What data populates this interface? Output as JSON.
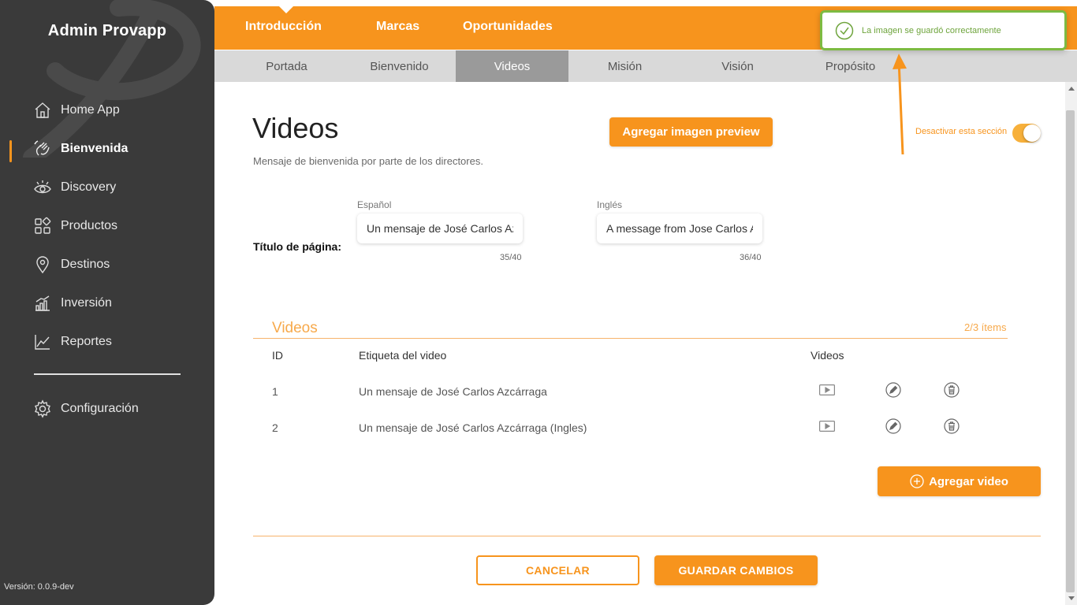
{
  "sidebar": {
    "brand": "Admin Provapp",
    "items": [
      {
        "label": "Home App",
        "icon": "home-icon"
      },
      {
        "label": "Bienvenida",
        "icon": "waving-hand-icon",
        "active": true
      },
      {
        "label": "Discovery",
        "icon": "eye-icon"
      },
      {
        "label": "Productos",
        "icon": "grid-icon"
      },
      {
        "label": "Destinos",
        "icon": "location-pin-icon"
      },
      {
        "label": "Inversión",
        "icon": "bar-chart-icon"
      },
      {
        "label": "Reportes",
        "icon": "line-chart-icon"
      }
    ],
    "settings": {
      "label": "Configuración",
      "icon": "gear-icon"
    },
    "version": "Versión: 0.0.9-dev"
  },
  "topnav": {
    "tabs": [
      {
        "label": "Introducción",
        "active": true
      },
      {
        "label": "Marcas"
      },
      {
        "label": "Oportunidades"
      }
    ]
  },
  "subnav": {
    "tabs": [
      {
        "label": "Portada"
      },
      {
        "label": "Bienvenido"
      },
      {
        "label": "Videos",
        "active": true
      },
      {
        "label": "Misión"
      },
      {
        "label": "Visión"
      },
      {
        "label": "Propósito"
      }
    ]
  },
  "main": {
    "title": "Videos",
    "subtitle": "Mensaje de bienvenida por parte de los directores.",
    "preview_button": "Agregar imagen preview",
    "toggle_label": "Desactivar esta sección",
    "toggle_on": true,
    "page_title_row": {
      "label": "Título de página:",
      "spanish": {
        "label": "Español",
        "value": "Un mensaje de José Carlos Az",
        "counter": "35/40"
      },
      "english": {
        "label": "Inglés",
        "value": "A message from Jose Carlos A",
        "counter": "36/40"
      }
    }
  },
  "videos": {
    "section_title": "Videos",
    "count": "2/3 ítems",
    "columns": [
      "ID",
      "Etiqueta del video",
      "Videos"
    ],
    "rows": [
      {
        "id": "1",
        "label": "Un mensaje de José Carlos Azcárraga"
      },
      {
        "id": "2",
        "label": "Un mensaje de José Carlos Azcárraga (Ingles)"
      }
    ],
    "add_button": "Agregar video"
  },
  "footer": {
    "cancel": "CANCELAR",
    "save": "GUARDAR CAMBIOS"
  },
  "toast": {
    "message": "La imagen se guardó correctamente",
    "icon": "check-circle-icon"
  },
  "colors": {
    "accent": "#f7941d",
    "sidebar": "#3a3a3a",
    "success": "#7dbb42"
  }
}
